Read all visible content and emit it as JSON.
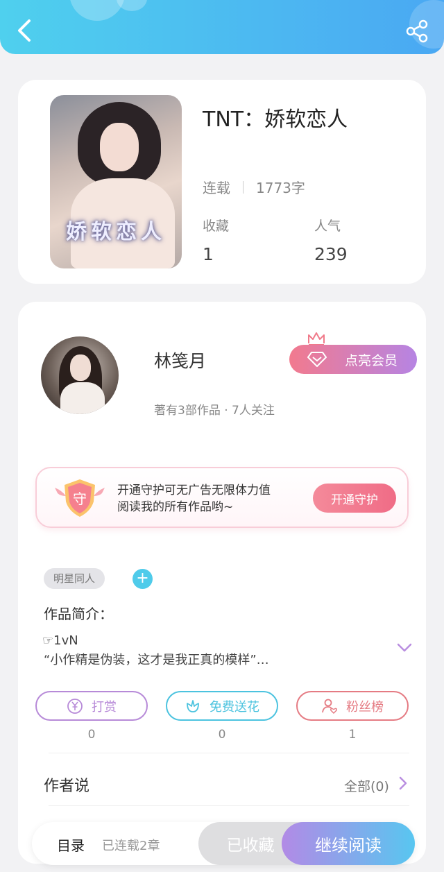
{
  "header": {
    "back_icon": "chevron-left-icon",
    "share_icon": "share-icon"
  },
  "book": {
    "cover_text": "娇软恋人",
    "title": "TNT：娇软恋人",
    "status": "连载",
    "word_count": "1773字",
    "stats": [
      {
        "label": "收藏",
        "value": "1"
      },
      {
        "label": "人气",
        "value": "239"
      }
    ]
  },
  "author": {
    "name": "林笺月",
    "meta": "著有3部作品 · 7人关注",
    "vip_button": "点亮会员"
  },
  "guard": {
    "icon_char": "守",
    "line1": "开通守护可无广告无限体力值",
    "line2": "阅读我的所有作品哟~",
    "button": "开通守护"
  },
  "tags": {
    "items": [
      "明星同人"
    ],
    "add": "+"
  },
  "intro": {
    "label": "作品简介：",
    "line1": "☞1vN",
    "line2": "“小作精是伪装，这才是我正真的模样”…"
  },
  "actions": [
    {
      "label": "打赏",
      "count": "0",
      "color": "#b78ad8",
      "icon": "yen-coin-icon"
    },
    {
      "label": "免费送花",
      "count": "0",
      "color": "#4cc3df",
      "icon": "flower-icon"
    },
    {
      "label": "粉丝榜",
      "count": "1",
      "color": "#e57b83",
      "icon": "fan-user-icon"
    }
  ],
  "author_says": {
    "label": "作者说",
    "all": "全部(0)"
  },
  "bottom": {
    "toc": "目录",
    "chapters": "已连载2章",
    "favorited": "已收藏",
    "continue": "继续阅读"
  }
}
